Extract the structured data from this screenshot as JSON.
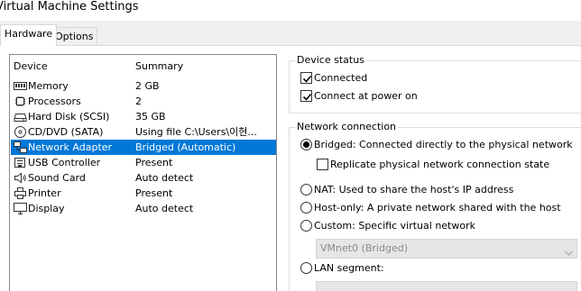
{
  "window": {
    "title": "Virtual Machine Settings"
  },
  "tabs": [
    {
      "label": "Hardware",
      "active": true
    },
    {
      "label": "Options",
      "active": false
    }
  ],
  "device_list": {
    "columns": [
      "Device",
      "Summary"
    ],
    "rows": [
      {
        "icon": "memory-icon",
        "device": "Memory",
        "summary": "2 GB",
        "selected": false
      },
      {
        "icon": "processor-icon",
        "device": "Processors",
        "summary": "2",
        "selected": false
      },
      {
        "icon": "hard-disk-icon",
        "device": "Hard Disk (SCSI)",
        "summary": "35 GB",
        "selected": false
      },
      {
        "icon": "cd-dvd-icon",
        "device": "CD/DVD (SATA)",
        "summary": "Using file C:\\Users\\이현...",
        "selected": false
      },
      {
        "icon": "network-adapter-icon",
        "device": "Network Adapter",
        "summary": "Bridged (Automatic)",
        "selected": true
      },
      {
        "icon": "usb-icon",
        "device": "USB Controller",
        "summary": "Present",
        "selected": false
      },
      {
        "icon": "sound-card-icon",
        "device": "Sound Card",
        "summary": "Auto detect",
        "selected": false
      },
      {
        "icon": "printer-icon",
        "device": "Printer",
        "summary": "Present",
        "selected": false
      },
      {
        "icon": "display-icon",
        "device": "Display",
        "summary": "Auto detect",
        "selected": false
      }
    ]
  },
  "device_status": {
    "legend": "Device status",
    "connected": {
      "label": "Connected",
      "checked": true
    },
    "connect_at_power_on": {
      "label": "Connect at power on",
      "checked": true
    }
  },
  "network_connection": {
    "legend": "Network connection",
    "bridged": {
      "label": "Bridged: Connected directly to the physical network",
      "selected": true
    },
    "replicate": {
      "label": "Replicate physical network connection state",
      "checked": false
    },
    "nat": {
      "label": "NAT: Used to share the host's IP address",
      "selected": false
    },
    "host_only": {
      "label": "Host-only: A private network shared with the host",
      "selected": false
    },
    "custom": {
      "label": "Custom: Specific virtual network",
      "selected": false
    },
    "custom_select": {
      "value": "VMnet0 (Bridged)",
      "enabled": false
    },
    "lan_segment": {
      "label": "LAN segment:",
      "selected": false
    },
    "lan_select": {
      "value": "",
      "enabled": false
    }
  },
  "colors": {
    "selection": "#0078d7",
    "dialog_background": "#f0f0f0",
    "disabled_text": "#8a8a8a"
  }
}
